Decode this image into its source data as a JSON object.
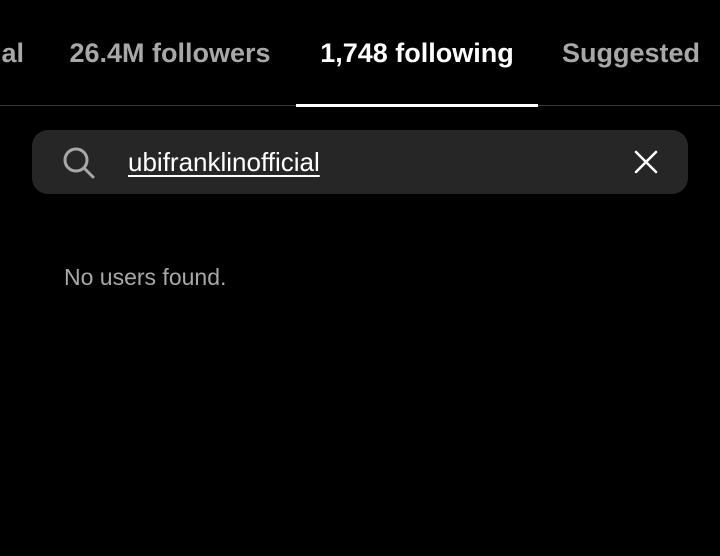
{
  "tabs": [
    {
      "label": "al",
      "active": false
    },
    {
      "label": "26.4M followers",
      "active": false
    },
    {
      "label": "1,748 following",
      "active": true
    },
    {
      "label": "Suggested",
      "active": false
    }
  ],
  "search": {
    "value": "ubifranklinofficial",
    "icon": "search-icon",
    "clear_icon": "close-icon"
  },
  "results": {
    "empty_message": "No users found."
  },
  "colors": {
    "background": "#000000",
    "search_bg": "#262626",
    "inactive_text": "#a8a8a8",
    "active_text": "#ffffff"
  }
}
